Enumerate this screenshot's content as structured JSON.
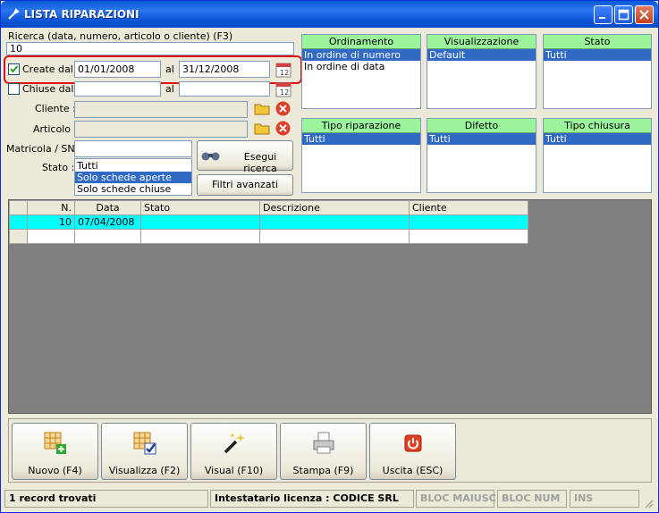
{
  "window": {
    "title": "LISTA RIPARAZIONI"
  },
  "search": {
    "label": "Ricerca (data, numero, articolo o cliente) (F3)",
    "value": "10"
  },
  "created": {
    "label": "Create dal",
    "checked": true,
    "from": "01/01/2008",
    "al": "al",
    "to": "31/12/2008"
  },
  "closed": {
    "label": "Chiuse dal",
    "checked": false,
    "from": "",
    "al": "al",
    "to": ""
  },
  "cliente": {
    "label": "Cliente :",
    "value": ""
  },
  "articolo": {
    "label": "Articolo :",
    "value": ""
  },
  "matricola": {
    "label": "Matricola / SN:",
    "value": ""
  },
  "stato": {
    "label": "Stato :",
    "options": [
      "Tutti",
      "Solo schede aperte",
      "Solo schede chiuse"
    ],
    "selected_index": 1
  },
  "buttons": {
    "search": "Esegui ricerca",
    "advanced": "Filtri avanzati"
  },
  "filters": [
    {
      "name": "ordinamento",
      "header": "Ordinamento",
      "items": [
        "In ordine di numero",
        "In ordine di data"
      ],
      "selected": 0
    },
    {
      "name": "visualizzazione",
      "header": "Visualizzazione",
      "items": [
        "Default"
      ],
      "selected": 0
    },
    {
      "name": "stato",
      "header": "Stato",
      "items": [
        "Tutti"
      ],
      "selected": 0
    },
    {
      "name": "tipo-riparazione",
      "header": "Tipo riparazione",
      "items": [
        "Tutti"
      ],
      "selected": 0
    },
    {
      "name": "difetto",
      "header": "Difetto",
      "items": [
        "Tutti"
      ],
      "selected": 0
    },
    {
      "name": "tipo-chiusura",
      "header": "Tipo chiusura",
      "items": [
        "Tutti"
      ],
      "selected": 0
    }
  ],
  "grid": {
    "columns": [
      "N.",
      "Data",
      "Stato",
      "Descrizione",
      "Cliente"
    ],
    "rows": [
      [
        "10",
        "07/04/2008",
        "",
        "",
        ""
      ],
      [
        "",
        "",
        "",
        "",
        ""
      ]
    ]
  },
  "toolbar": [
    {
      "name": "nuovo",
      "label": "Nuovo (F4)",
      "icon": "new-grid-icon"
    },
    {
      "name": "visualizza",
      "label": "Visualizza (F2)",
      "icon": "view-check-icon"
    },
    {
      "name": "visual",
      "label": "Visual (F10)",
      "icon": "magic-wand-icon"
    },
    {
      "name": "stampa",
      "label": "Stampa (F9)",
      "icon": "printer-icon"
    },
    {
      "name": "uscita",
      "label": "Uscita (ESC)",
      "icon": "power-icon"
    }
  ],
  "statusbar": {
    "records": "1 record trovati",
    "license": "Intestatario licenza : CODICE SRL",
    "caps": "BLOC MAIUSC",
    "num": "BLOC NUM",
    "ins": "INS"
  },
  "colors": {
    "accent": "#316ac5",
    "filter_header": "#9bf39b",
    "highlight_row": "#00ffff",
    "annotation": "#e01010"
  }
}
